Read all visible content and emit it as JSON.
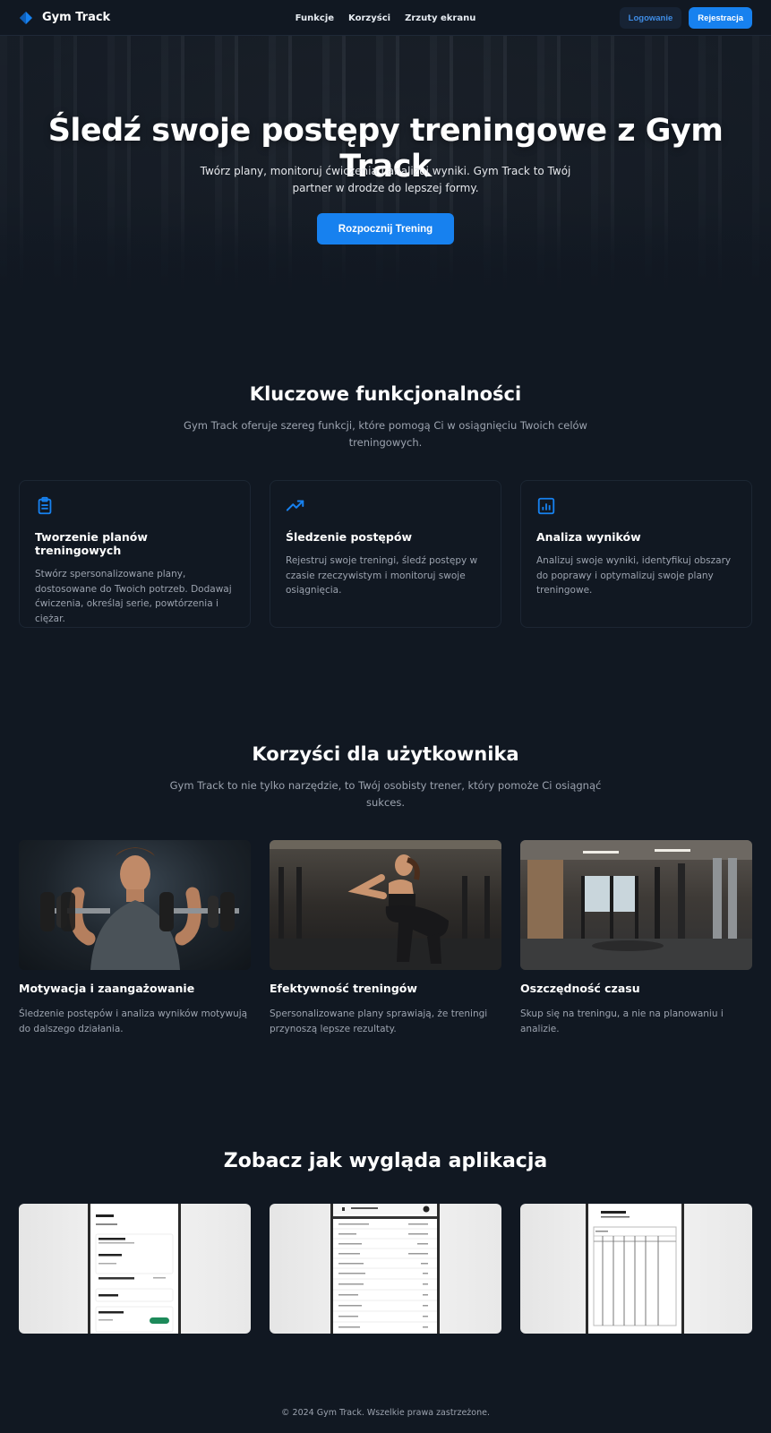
{
  "header": {
    "app_name": "Gym Track",
    "nav": [
      "Funkcje",
      "Korzyści",
      "Zrzuty ekranu"
    ],
    "login_label": "Logowanie",
    "register_label": "Rejestracja"
  },
  "hero": {
    "title": "Śledź swoje postępy treningowe z Gym Track",
    "subtitle": "Twórz plany, monitoruj ćwiczenia i analizuj wyniki. Gym Track to Twój partner w drodze do lepszej formy.",
    "cta_label": "Rozpocznij Trening"
  },
  "features": {
    "title": "Kluczowe funkcjonalności",
    "subtitle": "Gym Track oferuje szereg funkcji, które pomogą Ci w osiągnięciu Twoich celów treningowych.",
    "items": [
      {
        "icon": "clipboard-icon",
        "title": "Tworzenie planów treningowych",
        "text": "Stwórz spersonalizowane plany, dostosowane do Twoich potrzeb. Dodawaj ćwiczenia, określaj serie, powtórzenia i ciężar."
      },
      {
        "icon": "trending-up-icon",
        "title": "Śledzenie postępów",
        "text": "Rejestruj swoje treningi, śledź postępy w czasie rzeczywistym i monitoruj swoje osiągnięcia."
      },
      {
        "icon": "bar-chart-icon",
        "title": "Analiza wyników",
        "text": "Analizuj swoje wyniki, identyfikuj obszary do poprawy i optymalizuj swoje plany treningowe."
      }
    ]
  },
  "benefits": {
    "title": "Korzyści dla użytkownika",
    "subtitle": "Gym Track to nie tylko narzędzie, to Twój osobisty trener, który pomoże Ci osiągnąć sukces.",
    "items": [
      {
        "title": "Motywacja i zaangażowanie",
        "text": "Śledzenie postępów i analiza wyników motywują do dalszego działania."
      },
      {
        "title": "Efektywność treningów",
        "text": "Spersonalizowane plany sprawiają, że treningi przynoszą lepsze rezultaty."
      },
      {
        "title": "Oszczędność czasu",
        "text": "Skup się na treningu, a nie na planowaniu i analizie."
      }
    ]
  },
  "screens": {
    "title": "Zobacz jak wygląda aplikacja"
  },
  "footer": {
    "copyright": "© 2024 Gym Track. Wszelkie prawa zastrzeżone."
  },
  "colors": {
    "background": "#111822",
    "accent": "#1781ef"
  }
}
